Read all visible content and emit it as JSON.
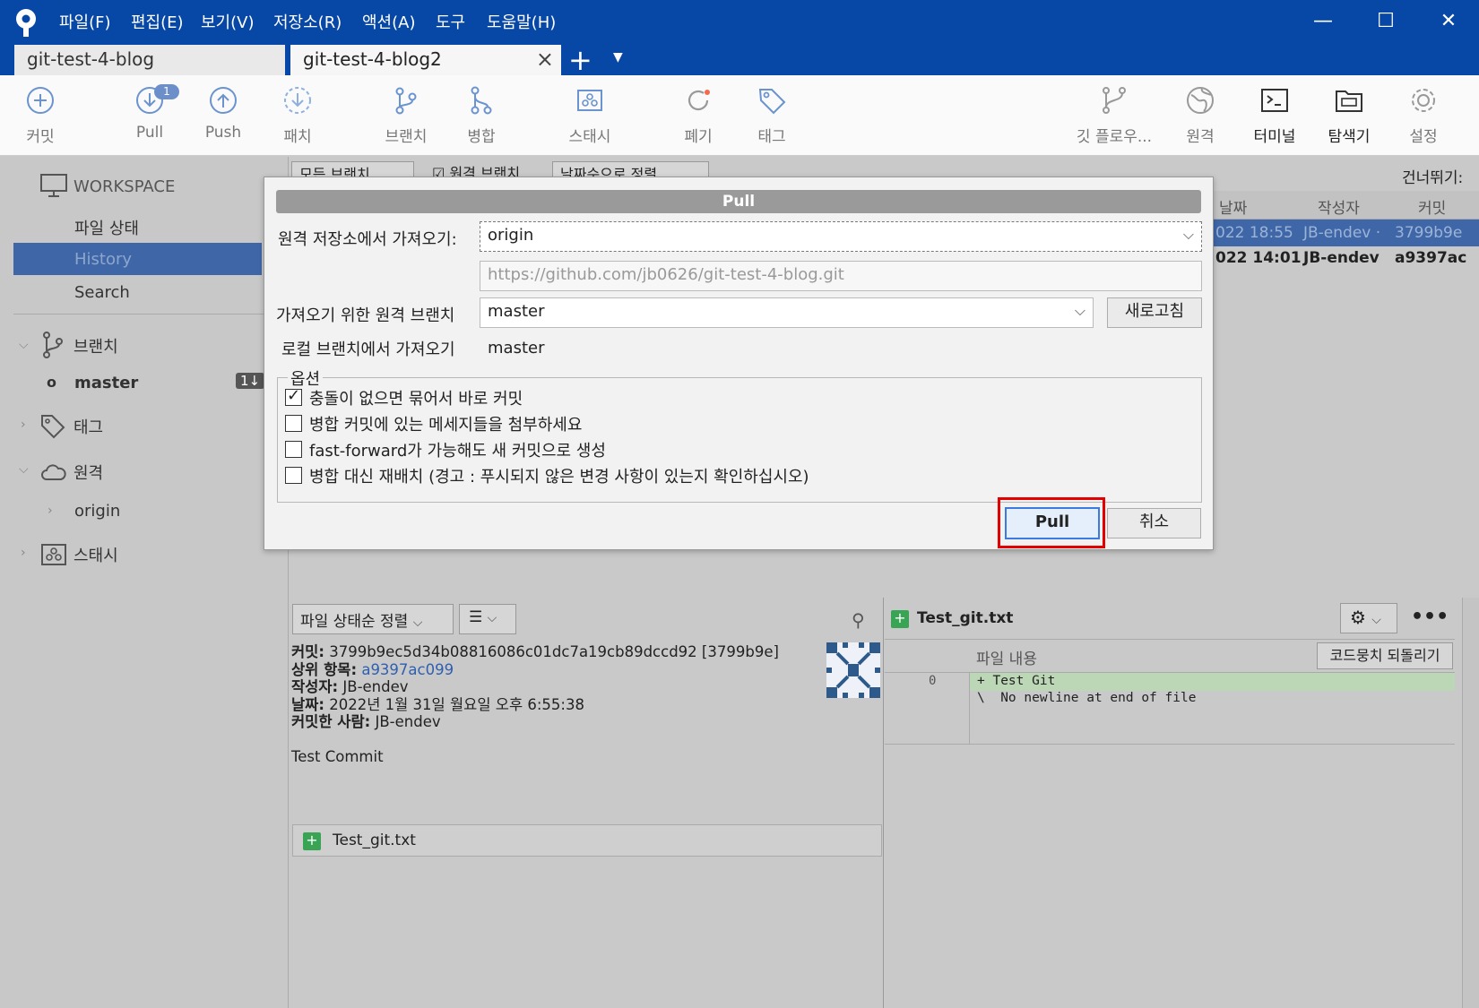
{
  "menu": [
    "파일(F)",
    "편집(E)",
    "보기(V)",
    "저장소(R)",
    "액션(A)",
    "도구",
    "도움말(H)"
  ],
  "window_controls": {
    "minimize": "—",
    "maximize": "☐",
    "close": "✕"
  },
  "tabs": [
    {
      "label": "git-test-4-blog"
    },
    {
      "label": "git-test-4-blog2"
    }
  ],
  "tab_add": "+",
  "toolbar": {
    "left": [
      {
        "label": "커밋",
        "icon": "commit-icon"
      },
      {
        "label": "Pull",
        "icon": "pull-icon",
        "badge": "1"
      },
      {
        "label": "Push",
        "icon": "push-icon"
      },
      {
        "label": "패치",
        "icon": "fetch-icon"
      },
      {
        "label": "브랜치",
        "icon": "branch-icon"
      },
      {
        "label": "병합",
        "icon": "merge-icon"
      },
      {
        "label": "스태시",
        "icon": "stash-icon"
      },
      {
        "label": "폐기",
        "icon": "discard-icon"
      },
      {
        "label": "태그",
        "icon": "tag-icon"
      }
    ],
    "right": [
      {
        "label": "깃 플로우...",
        "icon": "git-flow-icon"
      },
      {
        "label": "원격",
        "icon": "remote-icon"
      },
      {
        "label": "터미널",
        "icon": "terminal-icon"
      },
      {
        "label": "탐색기",
        "icon": "explorer-icon"
      },
      {
        "label": "설정",
        "icon": "settings-icon"
      }
    ]
  },
  "sidebar": {
    "workspace": "WORKSPACE",
    "file_status": "파일 상태",
    "history": "History",
    "search": "Search",
    "branches": "브랜치",
    "master": "master",
    "master_badge": "1↓",
    "tags": "태그",
    "remotes": "원격",
    "origin": "origin",
    "stashes": "스태시"
  },
  "log": {
    "filter_all_branches": "모든 브랜치",
    "filter_remote_branches": "원격 브랜치",
    "sort_by_date": "날짜순으로 정렬",
    "jump_to": "건너뛰기:",
    "columns": {
      "date": "날짜",
      "author": "작성자",
      "commit": "커밋"
    },
    "rows": [
      {
        "date": "022 18:55",
        "author": "JB-endev ·",
        "commit": "3799b9e"
      },
      {
        "date": "022 14:01",
        "author": "JB-endev",
        "commit": "a9397ac"
      }
    ]
  },
  "details": {
    "sort_label": "파일 상태순 정렬",
    "commit_label": "커밋:",
    "commit_value": "3799b9ec5d34b08816086c01dc7a19cb89dccd92 [3799b9e]",
    "parent_label": "상위 항목:",
    "parent_value": "a9397ac099",
    "author_label": "작성자:",
    "author_value": "JB-endev",
    "date_label": "날짜:",
    "date_value": "2022년 1월 31일 월요일 오후 6:55:38",
    "committer_label": "커밋한 사람:",
    "committer_value": "JB-endev",
    "message": "Test Commit",
    "file": "Test_git.txt"
  },
  "diff": {
    "file": "Test_git.txt",
    "content_label": "파일 내용",
    "revert_button": "코드뭉치 되돌리기",
    "line_no": "0",
    "line1": "+ Test Git",
    "line2": "\\  No newline at end of file"
  },
  "dialog": {
    "title": "Pull",
    "remote_label": "원격 저장소에서 가져오기:",
    "remote_value": "origin",
    "remote_url": "https://github.com/jb0626/git-test-4-blog.git",
    "remote_branch_label": "가져오기 위한 원격 브랜치",
    "remote_branch_value": "master",
    "refresh_button": "새로고침",
    "local_branch_label": "로컬 브랜치에서 가져오기",
    "local_branch_value": "master",
    "options_label": "옵션",
    "options": [
      {
        "label": "충돌이 없으면 묶어서 바로 커밋",
        "checked": true
      },
      {
        "label": "병합 커밋에 있는 메세지들을 첨부하세요",
        "checked": false
      },
      {
        "label": "fast-forward가 가능해도 새 커밋으로 생성",
        "checked": false
      },
      {
        "label": "병합 대신 재배치 (경고 : 푸시되지 않은 변경 사항이 있는지 확인하십시오)",
        "checked": false
      }
    ],
    "ok_button": "Pull",
    "cancel_button": "취소"
  },
  "colors": {
    "titlebar": "#0747a6",
    "selection": "#3f67a8",
    "highlight": "#e30000"
  }
}
